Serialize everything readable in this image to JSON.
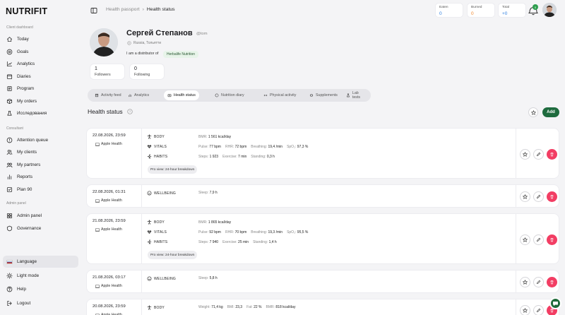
{
  "brand": "NUTRIFIT",
  "sidebar": {
    "sections": [
      {
        "title": "Client dashboard",
        "items": [
          {
            "label": "Today",
            "icon": "home-icon"
          },
          {
            "label": "Goals",
            "icon": "target-icon"
          },
          {
            "label": "Analytics",
            "icon": "analytics-icon"
          },
          {
            "label": "Diaries",
            "icon": "calendar-icon"
          },
          {
            "label": "Program",
            "icon": "program-icon"
          },
          {
            "label": "My orders",
            "icon": "orders-icon"
          },
          {
            "label": "Исследования",
            "icon": "research-icon"
          }
        ]
      },
      {
        "title": "Consultant",
        "items": [
          {
            "label": "Attention queue",
            "icon": "alert-icon"
          },
          {
            "label": "My clients",
            "icon": "clients-icon"
          },
          {
            "label": "My partners",
            "icon": "partners-icon"
          },
          {
            "label": "Reports",
            "icon": "reports-icon"
          },
          {
            "label": "Plan 90",
            "icon": "plan-icon"
          }
        ]
      },
      {
        "title": "Admin panel",
        "items": [
          {
            "label": "Admin panel",
            "icon": "admin-icon"
          },
          {
            "label": "Governance",
            "icon": "governance-icon"
          }
        ]
      }
    ],
    "bottom": [
      {
        "label": "Language",
        "icon": "flag-icon"
      },
      {
        "label": "Light mode",
        "icon": "sun-icon"
      },
      {
        "label": "Help",
        "icon": "help-icon"
      },
      {
        "label": "Logout",
        "icon": "logout-icon"
      }
    ]
  },
  "topbar": {
    "breadcrumb": [
      "Health passport",
      "Health status"
    ],
    "counters": [
      {
        "label": "Eaten",
        "value": "0",
        "color": "#2f7fe0"
      },
      {
        "label": "Burned",
        "value": "0",
        "color": "#f0862a"
      },
      {
        "label": "Total",
        "value": "+0",
        "color": "#2f7fe0"
      }
    ],
    "notifications": "0"
  },
  "profile": {
    "name": "Сергей Степанов",
    "handle": "@tom",
    "location": "Russia, Тольятти",
    "distributor_label": "I am a distributor of",
    "distributor": "Herbalife Nutrition",
    "stats": [
      {
        "value": "1",
        "label": "Followers"
      },
      {
        "value": "0",
        "label": "Following"
      }
    ]
  },
  "tabs": [
    {
      "label": "Activity feed"
    },
    {
      "label": "Analytics"
    },
    {
      "label": "Health status",
      "active": true
    },
    {
      "label": "Nutrition diary"
    },
    {
      "label": "Physical activity"
    },
    {
      "label": "Supplements"
    },
    {
      "label": "Lab tests"
    }
  ],
  "section": {
    "title": "Health status",
    "add_label": "Add"
  },
  "records": [
    {
      "date": "22.08.2026, 23:59",
      "source": "Apple Health",
      "rows": [
        {
          "key": "BODY",
          "icon": "body-icon",
          "metrics": [
            [
              "BMR:",
              "1 561 kcal/day"
            ]
          ]
        },
        {
          "key": "VITALS",
          "icon": "vitals-icon",
          "metrics": [
            [
              "Pulse:",
              "77 bpm"
            ],
            [
              "RHR:",
              "72 bpm"
            ],
            [
              "Breathing:",
              "19,4 /min"
            ],
            [
              "SpO₂:",
              "97,3 %"
            ]
          ]
        },
        {
          "key": "HABITS",
          "icon": "habits-icon",
          "metrics": [
            [
              "Steps:",
              "1 923"
            ],
            [
              "Exercise:",
              "7 min"
            ],
            [
              "Standing:",
              "0,3 h"
            ]
          ]
        }
      ],
      "pro": "Pro view: 24-hour breakdown"
    },
    {
      "date": "22.08.2026, 01:31",
      "source": "Apple Health",
      "rows": [
        {
          "key": "WELLBEING",
          "icon": "wellbeing-icon",
          "metrics": [
            [
              "Sleep:",
              "7,9 h"
            ]
          ]
        }
      ]
    },
    {
      "date": "21.08.2026, 23:59",
      "source": "Apple Health",
      "rows": [
        {
          "key": "BODY",
          "icon": "body-icon",
          "metrics": [
            [
              "BMR:",
              "1 865 kcal/day"
            ]
          ]
        },
        {
          "key": "VITALS",
          "icon": "vitals-icon",
          "metrics": [
            [
              "Pulse:",
              "92 bpm"
            ],
            [
              "RHR:",
              "70 bpm"
            ],
            [
              "Breathing:",
              "19,3 /min"
            ],
            [
              "SpO₂:",
              "95,5 %"
            ]
          ]
        },
        {
          "key": "HABITS",
          "icon": "habits-icon",
          "metrics": [
            [
              "Steps:",
              "7 940"
            ],
            [
              "Exercise:",
              "25 min"
            ],
            [
              "Standing:",
              "1,4 h"
            ]
          ]
        }
      ],
      "pro": "Pro view: 24-hour breakdown"
    },
    {
      "date": "21.08.2026, 03:17",
      "source": "Apple Health",
      "rows": [
        {
          "key": "WELLBEING",
          "icon": "wellbeing-icon",
          "metrics": [
            [
              "Sleep:",
              "5,8 h"
            ]
          ]
        }
      ]
    },
    {
      "date": "20.08.2026, 23:59",
      "source": "Apple Health",
      "rows": [
        {
          "key": "BODY",
          "icon": "body-icon",
          "metrics": [
            [
              "Weight:",
              "71,4 kg"
            ],
            [
              "BMI:",
              "23,3"
            ],
            [
              "Fat:",
              "22 %"
            ],
            [
              "BMR:",
              "818 kcal/day"
            ]
          ]
        }
      ]
    }
  ]
}
